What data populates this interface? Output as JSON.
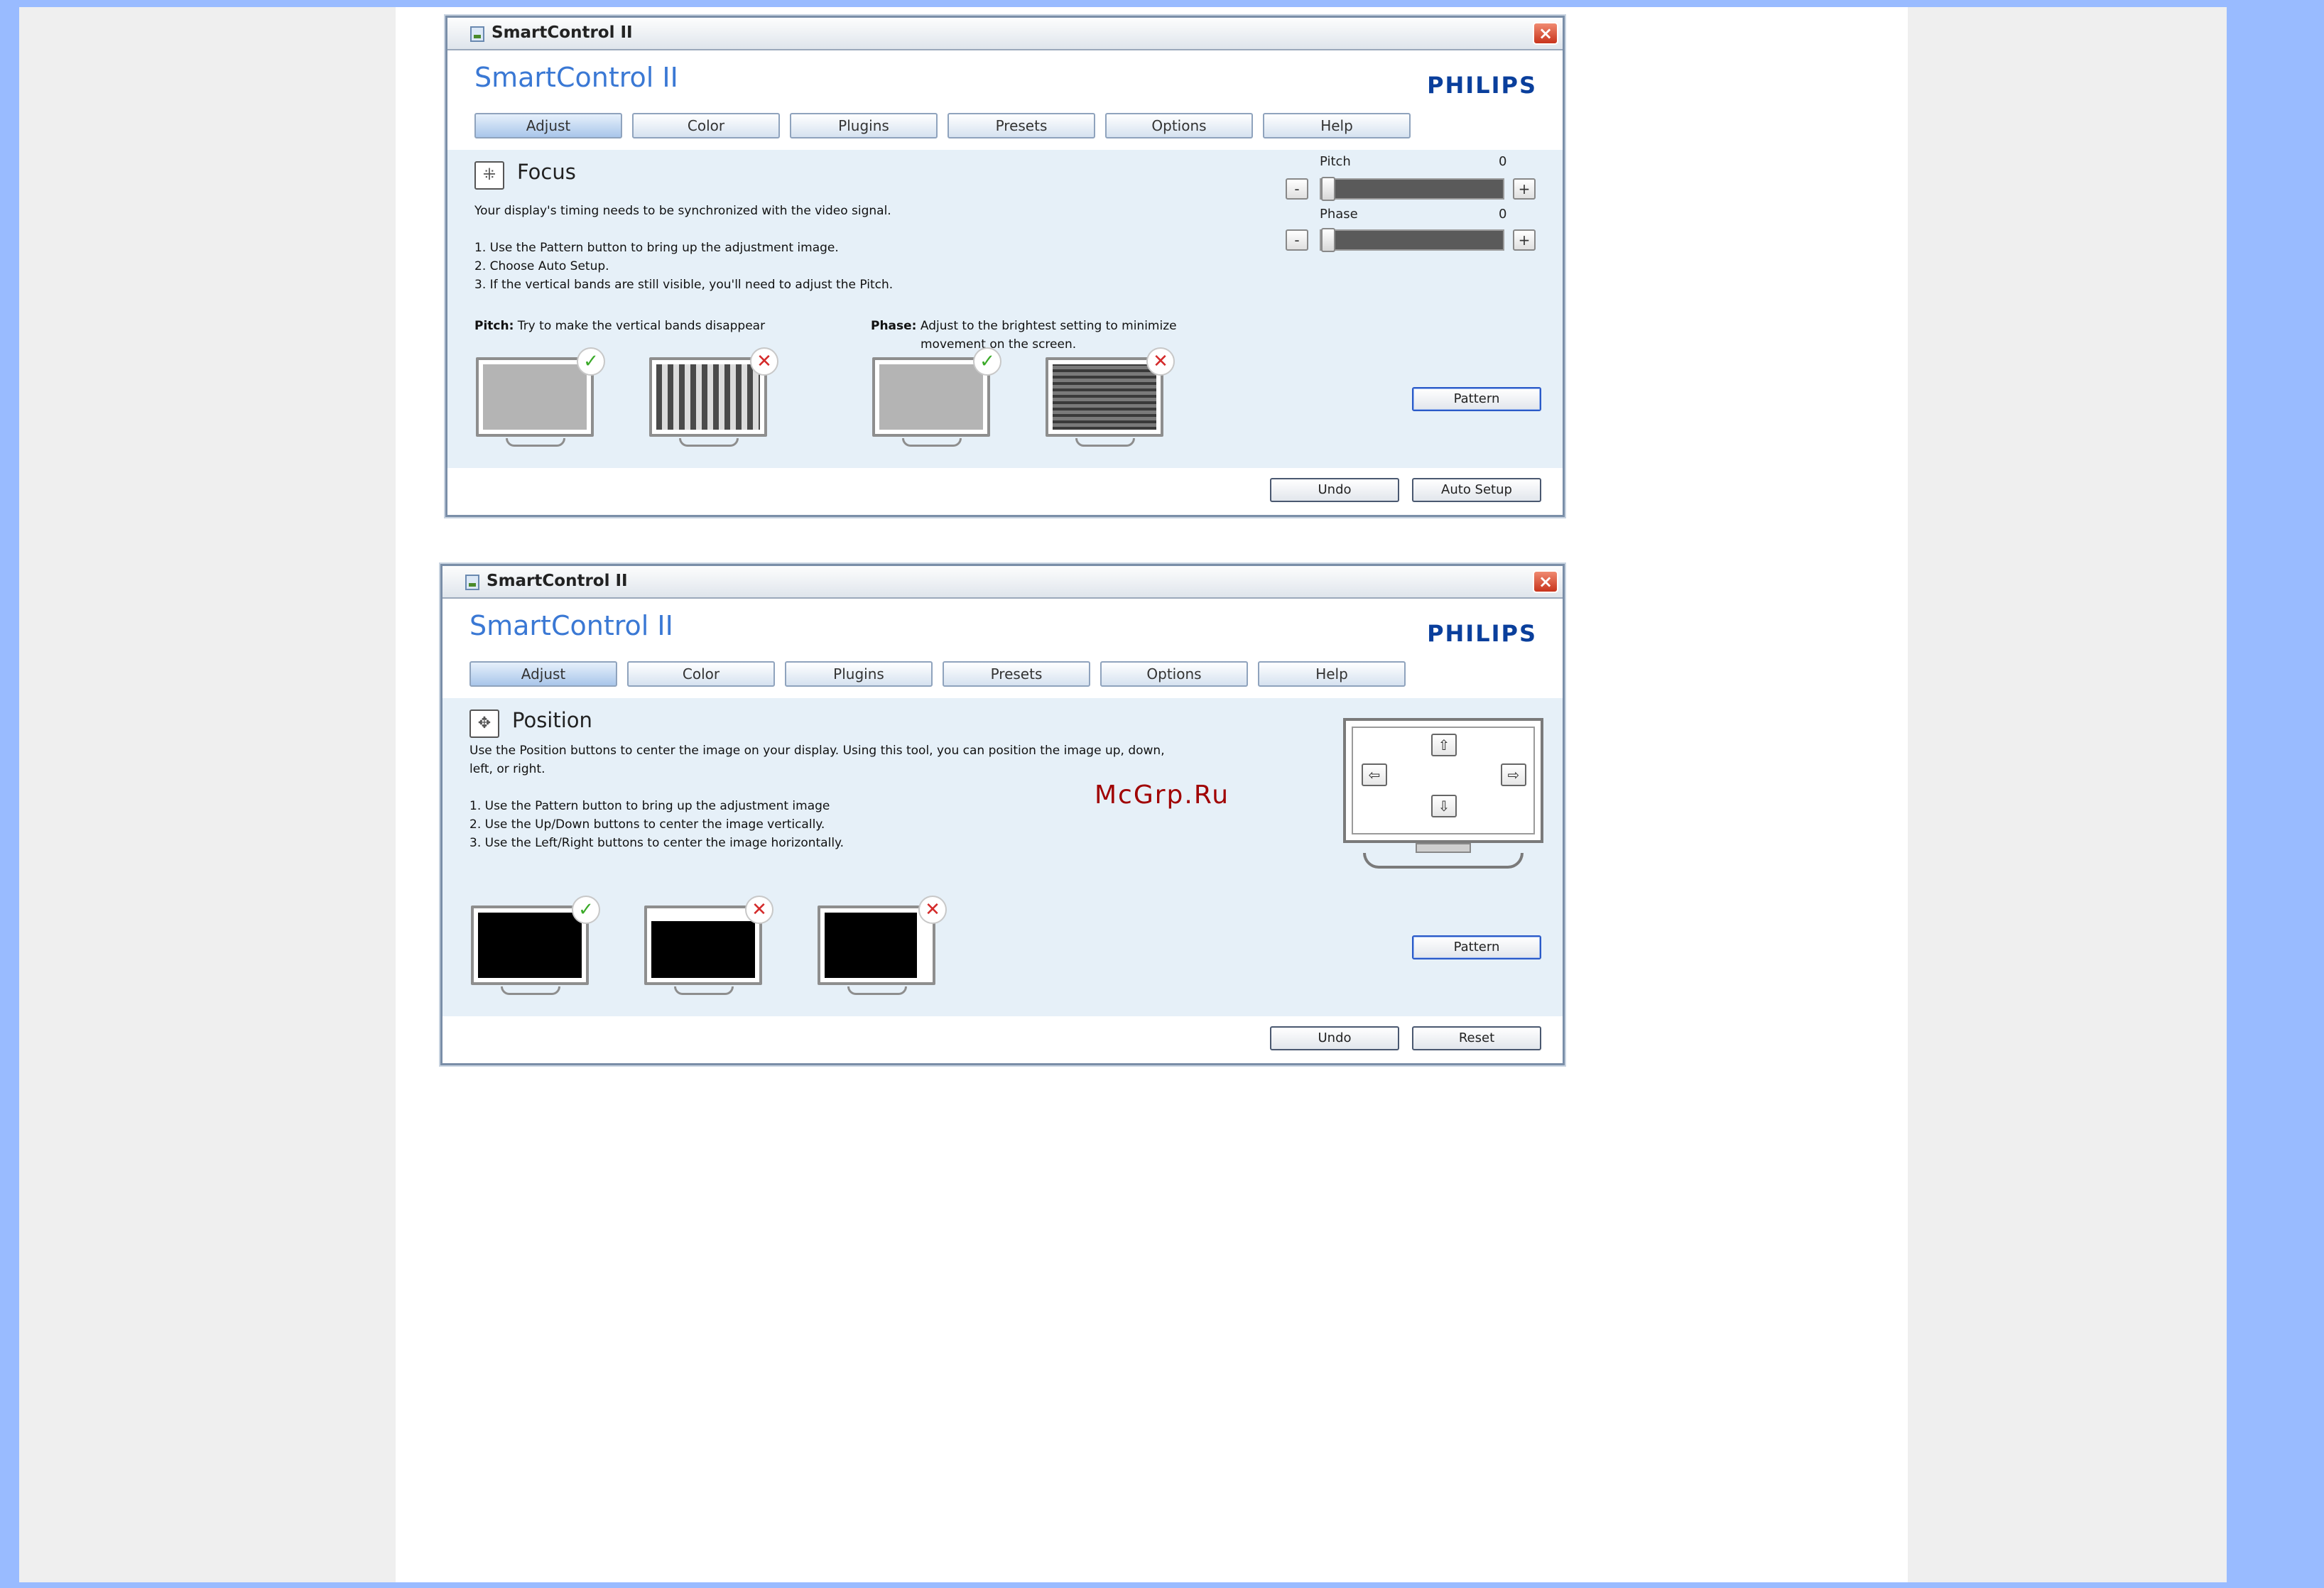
{
  "colors": {
    "page_bg": "#99bbff",
    "accent": "#3a78d4",
    "brand": "#0a3f9c"
  },
  "window1": {
    "title": "SmartControl II",
    "app_title": "SmartControl II",
    "brand": "PHILIPS",
    "tabs": [
      "Adjust",
      "Color",
      "Plugins",
      "Presets",
      "Options",
      "Help"
    ],
    "active_tab": "Adjust",
    "section_title": "Focus",
    "description": "Your display's timing needs to be synchronized with the video signal.",
    "steps": [
      "1. Use the Pattern button to bring up the adjustment image.",
      "2. Choose Auto Setup.",
      "3. If the vertical bands are still visible, you'll need to adjust the Pitch."
    ],
    "pitch_caption_bold": "Pitch:",
    "pitch_caption": " Try to make the vertical bands disappear",
    "phase_caption_bold": "Phase:",
    "phase_caption_line1": " Adjust to the brightest setting to minimize",
    "phase_caption_line2": "movement on the screen.",
    "pitch_label": "Pitch",
    "pitch_value": "0",
    "phase_label": "Phase",
    "phase_value": "0",
    "minus_label": "-",
    "plus_label": "+",
    "pattern_button": "Pattern",
    "undo_button": "Undo",
    "auto_setup_button": "Auto Setup",
    "ok_mark": "✓",
    "bad_mark": "✕"
  },
  "window2": {
    "title": "SmartControl II",
    "app_title": "SmartControl II",
    "brand": "PHILIPS",
    "tabs": [
      "Adjust",
      "Color",
      "Plugins",
      "Presets",
      "Options",
      "Help"
    ],
    "active_tab": "Adjust",
    "section_title": "Position",
    "description_line1": "Use the Position buttons to center the image on your display. Using this tool, you can position the image up, down,",
    "description_line2": "left, or right.",
    "steps": [
      "1. Use the Pattern button to bring up the adjustment image",
      "2. Use the Up/Down buttons to center the image vertically.",
      "3. Use the Left/Right buttons to center the image horizontally."
    ],
    "arrow_up": "⇧",
    "arrow_down": "⇩",
    "arrow_left": "⇦",
    "arrow_right": "⇨",
    "pattern_button": "Pattern",
    "undo_button": "Undo",
    "reset_button": "Reset",
    "ok_mark": "✓",
    "bad_mark": "✕"
  },
  "watermark": "McGrp.Ru"
}
